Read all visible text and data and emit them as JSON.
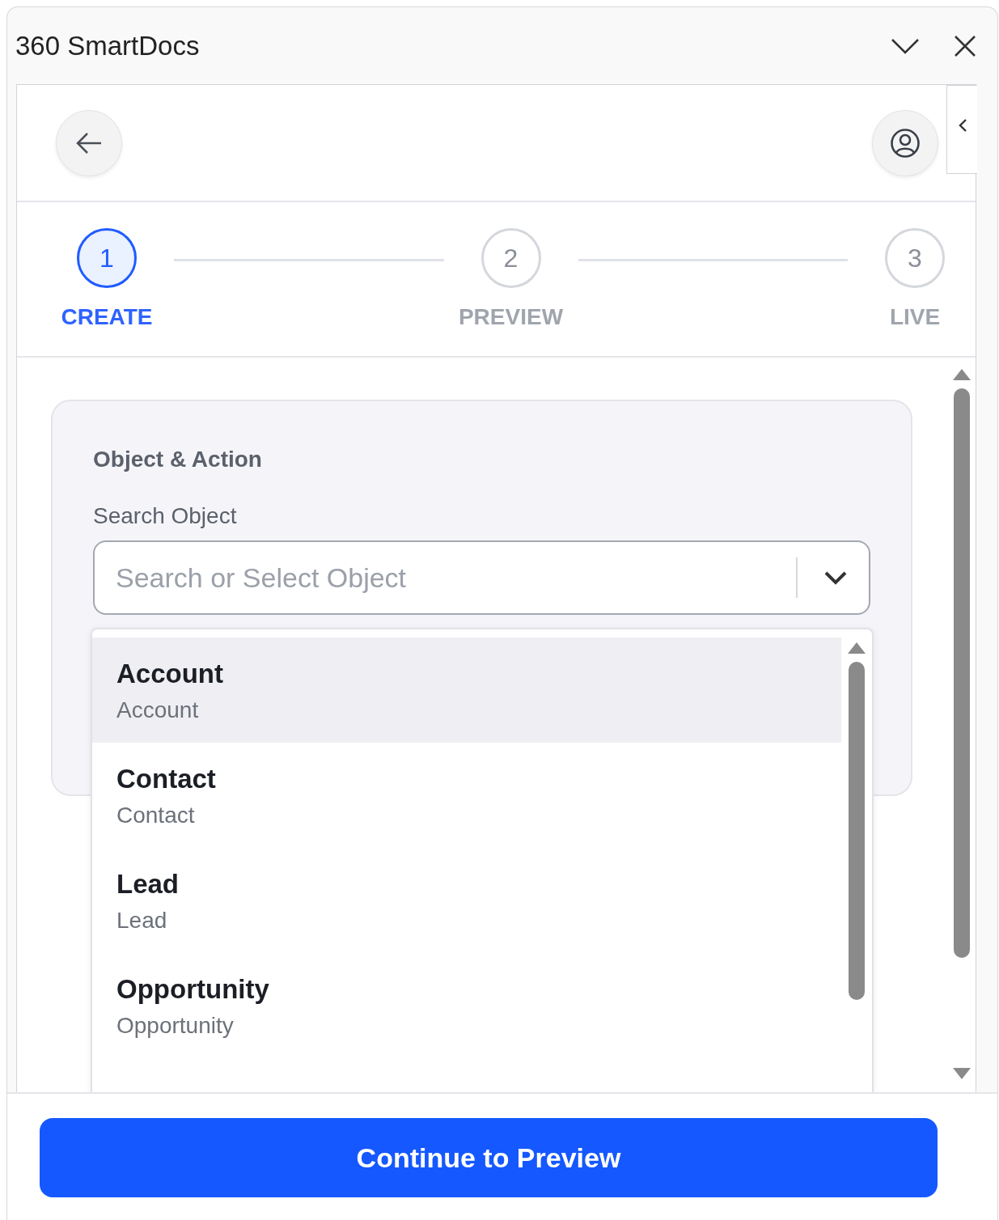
{
  "window": {
    "title": "360 SmartDocs"
  },
  "steps": [
    {
      "number": "1",
      "label": "CREATE",
      "selected": true
    },
    {
      "number": "2",
      "label": "PREVIEW",
      "selected": false
    },
    {
      "number": "3",
      "label": "LIVE",
      "selected": false
    }
  ],
  "card": {
    "title": "Object & Action",
    "field_label": "Search Object",
    "search": {
      "placeholder": "Search or Select Object"
    }
  },
  "dropdown": {
    "items": [
      {
        "name": "Account",
        "api_name": "Account",
        "selected": true
      },
      {
        "name": "Contact",
        "api_name": "Contact",
        "selected": false
      },
      {
        "name": "Lead",
        "api_name": "Lead",
        "selected": false
      },
      {
        "name": "Opportunity",
        "api_name": "Opportunity",
        "selected": false
      }
    ]
  },
  "footer": {
    "button": "Continue to Preview"
  }
}
